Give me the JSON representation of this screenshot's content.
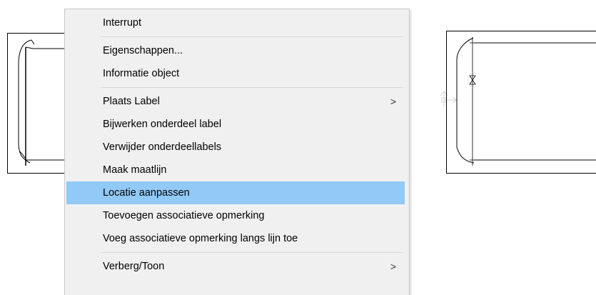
{
  "context_menu": {
    "items": [
      {
        "label": "Interrupt",
        "submenu": false,
        "highlighted": false
      },
      {
        "type": "separator"
      },
      {
        "label": "Eigenschappen...",
        "submenu": false,
        "highlighted": false
      },
      {
        "label": "Informatie object",
        "submenu": false,
        "highlighted": false
      },
      {
        "type": "separator"
      },
      {
        "label": "Plaats Label",
        "submenu": true,
        "arrow": ">",
        "highlighted": false
      },
      {
        "label": "Bijwerken onderdeel label",
        "submenu": false,
        "highlighted": false
      },
      {
        "label": "Verwijder onderdeellabels",
        "submenu": false,
        "highlighted": false
      },
      {
        "label": "Maak maatlijn",
        "submenu": false,
        "highlighted": false
      },
      {
        "label": "Locatie aanpassen",
        "submenu": false,
        "highlighted": true
      },
      {
        "label": "Toevoegen associatieve opmerking",
        "submenu": false,
        "highlighted": false
      },
      {
        "label": "Voeg associatieve opmerking langs lijn toe",
        "submenu": false,
        "highlighted": false
      },
      {
        "type": "separator"
      },
      {
        "label": "Verberg/Toon",
        "submenu": true,
        "arrow": ">",
        "highlighted": false
      }
    ],
    "highlight_color": "#91c9f7",
    "background_color": "#f0f0f0"
  },
  "drawing": {
    "left_view_icon": "drawing-view-frame",
    "right_view_icon": "drawing-view-frame",
    "location_marker_icon": "coordinate-axis-icon"
  }
}
